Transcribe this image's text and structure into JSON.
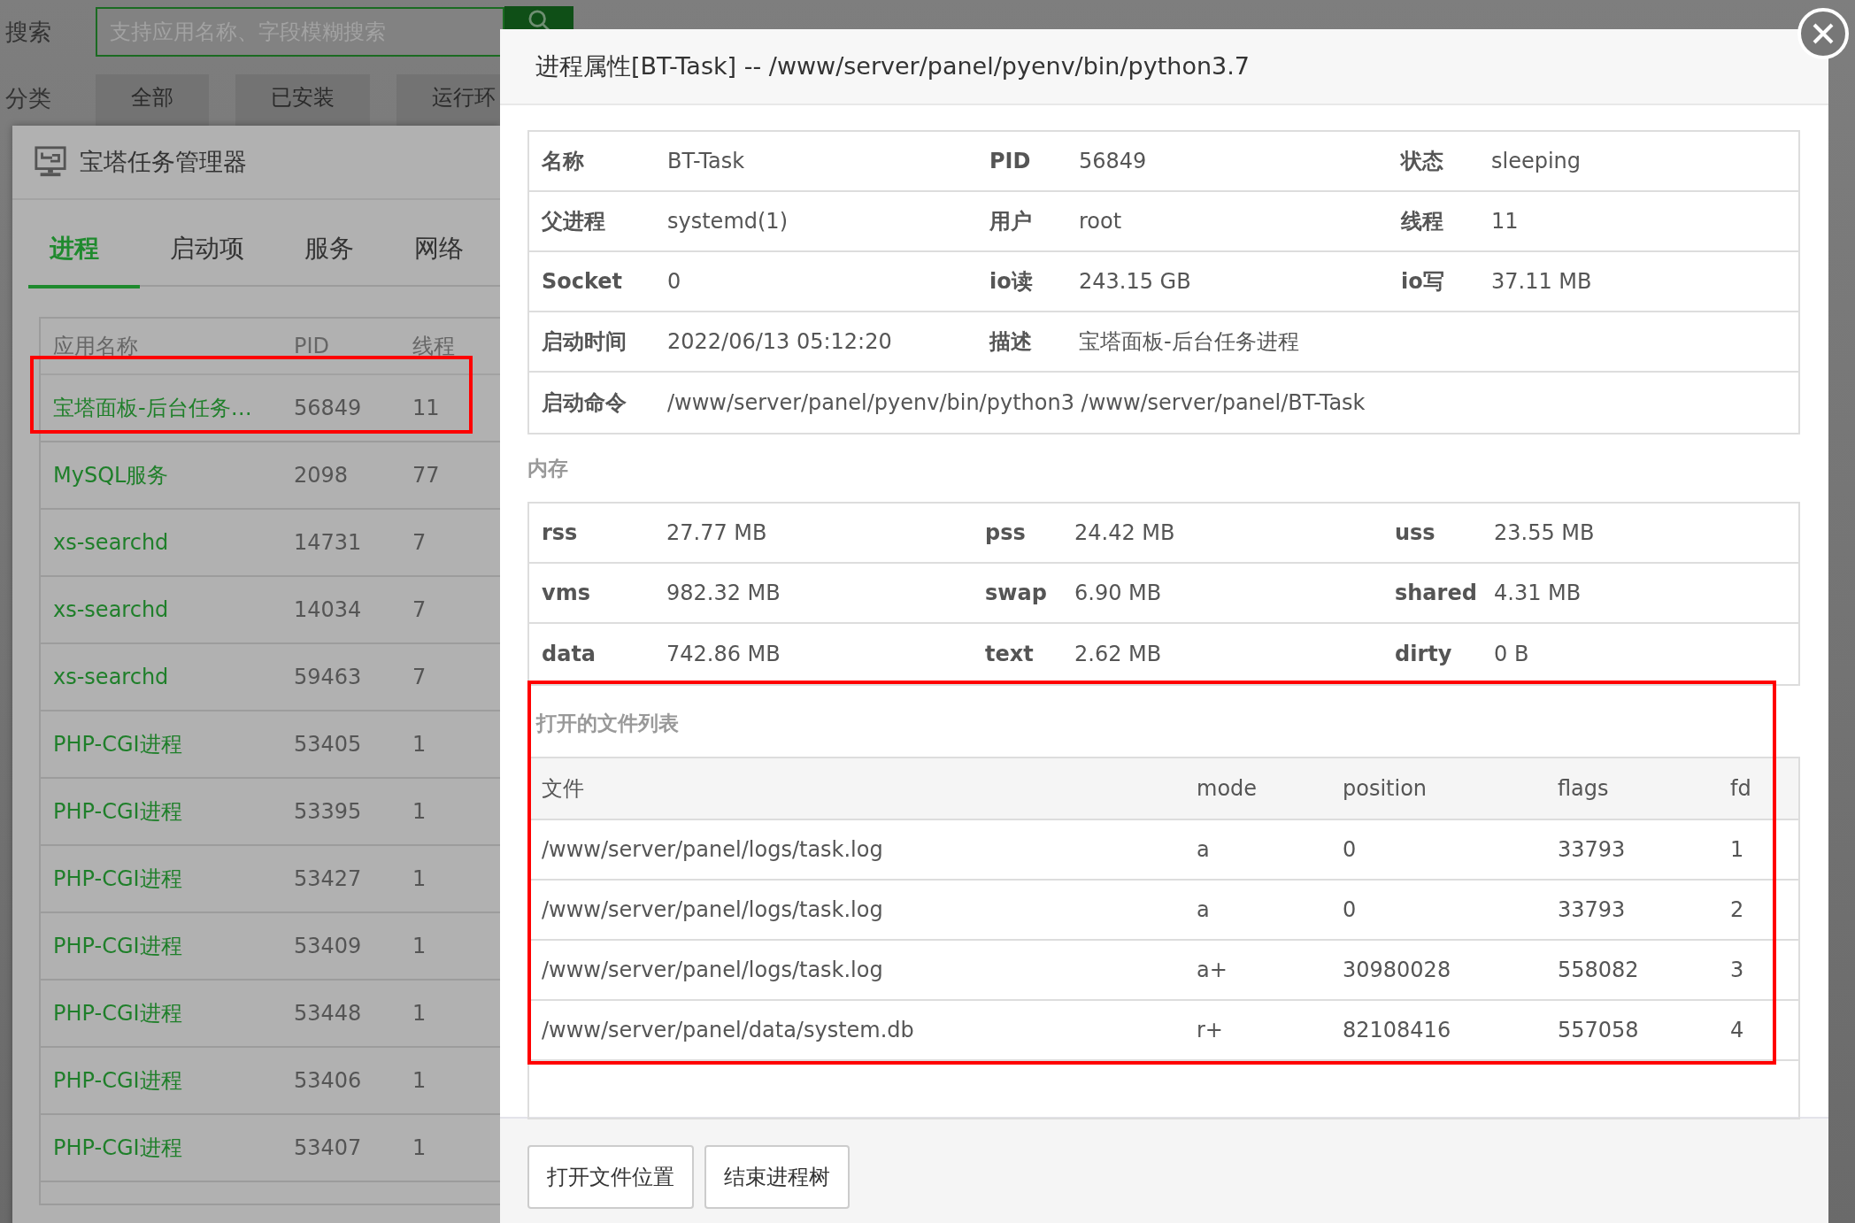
{
  "background_page": {
    "search_label": "搜索",
    "search_field": {
      "placeholder": "支持应用名称、字段模糊搜索"
    },
    "category_label": "分类",
    "category_tabs": [
      "全部",
      "已安装",
      "运行环"
    ]
  },
  "task_manager": {
    "title": "宝塔任务管理器",
    "tabs": [
      {
        "label": "进程",
        "selected": true
      },
      {
        "label": "启动项",
        "selected": false
      },
      {
        "label": "服务",
        "selected": false
      },
      {
        "label": "网络",
        "selected": false
      }
    ],
    "table": {
      "columns": [
        "应用名称",
        "PID",
        "线程"
      ],
      "rows": [
        {
          "name": "宝塔面板-后台任务…",
          "pid": "56849",
          "threads": "11",
          "highlighted": true
        },
        {
          "name": "MySQL服务",
          "pid": "2098",
          "threads": "77",
          "highlighted": false
        },
        {
          "name": "xs-searchd",
          "pid": "14731",
          "threads": "7",
          "highlighted": false
        },
        {
          "name": "xs-searchd",
          "pid": "14034",
          "threads": "7",
          "highlighted": false
        },
        {
          "name": "xs-searchd",
          "pid": "59463",
          "threads": "7",
          "highlighted": false
        },
        {
          "name": "PHP-CGI进程",
          "pid": "53405",
          "threads": "1",
          "highlighted": false
        },
        {
          "name": "PHP-CGI进程",
          "pid": "53395",
          "threads": "1",
          "highlighted": false
        },
        {
          "name": "PHP-CGI进程",
          "pid": "53427",
          "threads": "1",
          "highlighted": false
        },
        {
          "name": "PHP-CGI进程",
          "pid": "53409",
          "threads": "1",
          "highlighted": false
        },
        {
          "name": "PHP-CGI进程",
          "pid": "53448",
          "threads": "1",
          "highlighted": false
        },
        {
          "name": "PHP-CGI进程",
          "pid": "53406",
          "threads": "1",
          "highlighted": false
        },
        {
          "name": "PHP-CGI进程",
          "pid": "53407",
          "threads": "1",
          "highlighted": false
        }
      ]
    }
  },
  "dialog": {
    "title": "进程属性[BT-Task] -- /www/server/panel/pyenv/bin/python3.7",
    "info": [
      [
        {
          "label": "名称",
          "value": "BT-Task"
        },
        {
          "label": "PID",
          "value": "56849"
        },
        {
          "label": "状态",
          "value": "sleeping"
        }
      ],
      [
        {
          "label": "父进程",
          "value": "systemd(1)"
        },
        {
          "label": "用户",
          "value": "root"
        },
        {
          "label": "线程",
          "value": "11"
        }
      ],
      [
        {
          "label": "Socket",
          "value": "0"
        },
        {
          "label": "io读",
          "value": "243.15 GB"
        },
        {
          "label": "io写",
          "value": "37.11 MB"
        }
      ],
      [
        {
          "label": "启动时间",
          "value": "2022/06/13 05:12:20"
        },
        {
          "label": "描述",
          "value": "宝塔面板-后台任务进程"
        }
      ],
      [
        {
          "label": "启动命令",
          "value": "/www/server/panel/pyenv/bin/python3 /www/server/panel/BT-Task"
        }
      ]
    ],
    "memory_title": "内存",
    "memory": [
      [
        {
          "label": "rss",
          "value": "27.77 MB"
        },
        {
          "label": "pss",
          "value": "24.42 MB"
        },
        {
          "label": "uss",
          "value": "23.55 MB"
        }
      ],
      [
        {
          "label": "vms",
          "value": "982.32 MB"
        },
        {
          "label": "swap",
          "value": "6.90 MB"
        },
        {
          "label": "shared",
          "value": "4.31 MB"
        }
      ],
      [
        {
          "label": "data",
          "value": "742.86 MB"
        },
        {
          "label": "text",
          "value": "2.62 MB"
        },
        {
          "label": "dirty",
          "value": "0 B"
        }
      ]
    ],
    "files_title": "打开的文件列表",
    "files_highlighted": true,
    "files": {
      "columns": [
        "文件",
        "mode",
        "position",
        "flags",
        "fd"
      ],
      "rows": [
        [
          "/www/server/panel/logs/task.log",
          "a",
          "0",
          "33793",
          "1"
        ],
        [
          "/www/server/panel/logs/task.log",
          "a",
          "0",
          "33793",
          "2"
        ],
        [
          "/www/server/panel/logs/task.log",
          "a+",
          "30980028",
          "558082",
          "3"
        ],
        [
          "/www/server/panel/data/system.db",
          "r+",
          "82108416",
          "557058",
          "4"
        ]
      ]
    },
    "buttons": [
      "打开文件位置",
      "结束进程树"
    ]
  }
}
